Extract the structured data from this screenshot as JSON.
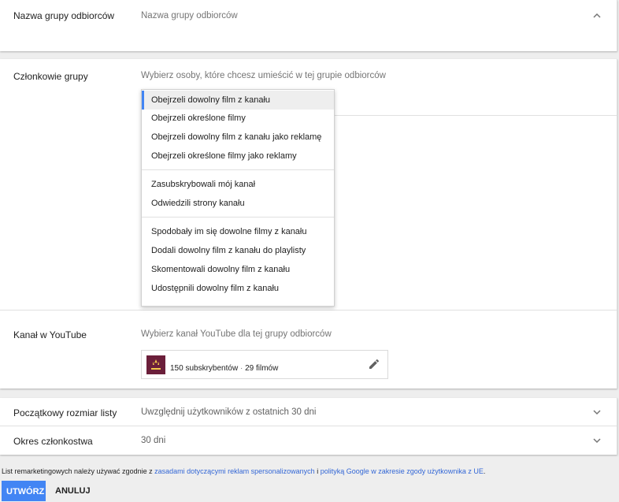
{
  "audience_name": {
    "label": "Nazwa grupy odbiorców",
    "placeholder": "Nazwa grupy odbiorców"
  },
  "members": {
    "label": "Członkowie grupy",
    "placeholder": "Wybierz osoby, które chcesz umieścić w tej grupie odbiorców",
    "menu_group1": [
      "Obejrzeli dowolny film z kanału",
      "Obejrzeli określone filmy",
      "Obejrzeli dowolny film z kanału jako reklamę",
      "Obejrzeli określone filmy jako reklamy"
    ],
    "menu_group2": [
      "Zasubskrybowali mój kanał",
      "Odwiedzili strony kanału"
    ],
    "menu_group3": [
      "Spodobały im się dowolne filmy z kanału",
      "Dodali dowolny film z kanału do playlisty",
      "Skomentowali dowolny film z kanału",
      "Udostępnili dowolny film z kanału"
    ]
  },
  "youtube_channel": {
    "label": "Kanał w YouTube",
    "placeholder": "Wybierz kanał YouTube dla tej grupy odbiorców",
    "subscribers": "150 subskrybentów",
    "separator": "·",
    "videos": "29 filmów"
  },
  "initial_size": {
    "label": "Początkowy rozmiar listy",
    "value": "Uwzględnij użytkowników z ostatnich 30 dni"
  },
  "membership": {
    "label": "Okres członkostwa",
    "value": "30 dni"
  },
  "footer": {
    "note_prefix": "List remarketingowych należy używać zgodnie z",
    "link1": "zasadami dotyczącymi reklam spersonalizowanych",
    "mid": "i",
    "link2": "polityką Google w zakresie zgody użytkownika z UE",
    "note_suffix": ".",
    "create": "UTWÓRZ",
    "cancel": "ANULUJ"
  },
  "colors": {
    "accent": "#4285f4",
    "link": "#3367d6",
    "thumbnail": "#6b1f3a"
  }
}
